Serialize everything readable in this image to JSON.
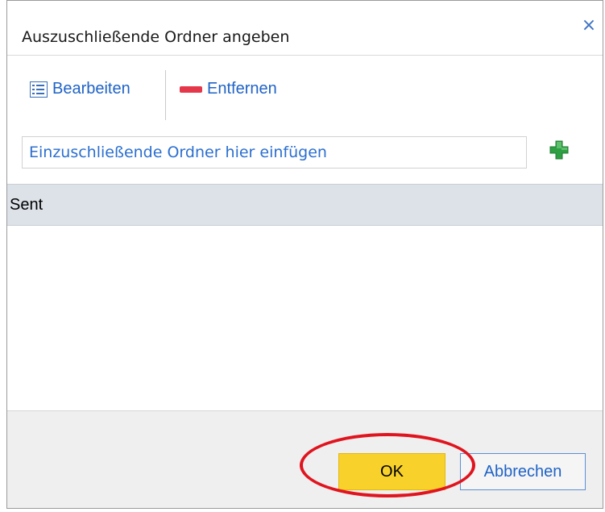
{
  "dialog": {
    "title": "Auszuschließende Ordner angeben",
    "close_icon": "close-icon"
  },
  "toolbar": {
    "edit_label": "Bearbeiten",
    "remove_label": "Entfernen",
    "edit_icon": "list-edit-icon",
    "remove_icon": "minus-icon"
  },
  "folder_input": {
    "placeholder": "Einzuschließende Ordner hier einfügen",
    "value": "",
    "add_icon": "plus-icon"
  },
  "folder_list": {
    "items": [
      "Sent"
    ]
  },
  "footer": {
    "ok_label": "OK",
    "cancel_label": "Abbrechen"
  },
  "colors": {
    "accent": "#1f63c6",
    "ok_button": "#f8d12a",
    "remove_red": "#e5374a",
    "add_green": "#2ea043",
    "highlight_ring": "#e0141e"
  }
}
